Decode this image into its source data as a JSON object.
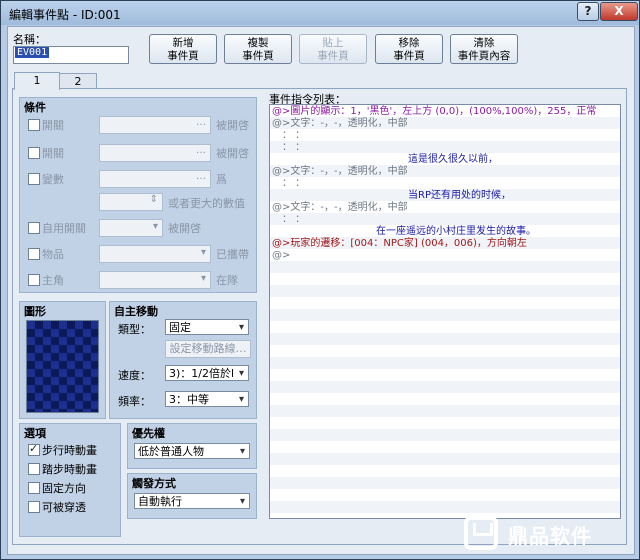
{
  "window": {
    "title": "編輯事件點 - ID:001",
    "help": "?",
    "close": "X"
  },
  "name": {
    "label": "名稱：",
    "value": "EV001"
  },
  "toolbar": [
    {
      "l1": "新增",
      "l2": "事件頁",
      "enabled": true
    },
    {
      "l1": "複製",
      "l2": "事件頁",
      "enabled": true
    },
    {
      "l1": "貼上",
      "l2": "事件頁",
      "enabled": false
    },
    {
      "l1": "移除",
      "l2": "事件頁",
      "enabled": true
    },
    {
      "l1": "清除",
      "l2": "事件頁內容",
      "enabled": true
    }
  ],
  "tabs": [
    "1",
    "2"
  ],
  "conditions": {
    "title": "條件",
    "switch1": {
      "label": "開關",
      "suffix": "被開啓"
    },
    "switch2": {
      "label": "開關",
      "suffix": "被開啓"
    },
    "variable": {
      "label": "變數",
      "suffix": "爲",
      "hint": "或者更大的數值"
    },
    "self_switch": {
      "label": "自用開關",
      "suffix": "被開啓"
    },
    "item": {
      "label": "物品",
      "suffix": "已攜帶"
    },
    "actor": {
      "label": "主角",
      "suffix": "在隊"
    }
  },
  "graphic": {
    "title": "圖形"
  },
  "autonomous": {
    "title": "自主移動",
    "type_label": "類型：",
    "type_value": "固定",
    "route_button": "設定移動路線…",
    "speed_label": "速度：",
    "speed_value": "3)：1/2倍於l",
    "freq_label": "頻率：",
    "freq_value": "3：中等"
  },
  "options": {
    "title": "選項",
    "items": [
      {
        "label": "步行時動畫",
        "checked": true
      },
      {
        "label": "踏步時動畫",
        "checked": false
      },
      {
        "label": "固定方向",
        "checked": false
      },
      {
        "label": "可被穿透",
        "checked": false
      }
    ]
  },
  "priority": {
    "title": "優先權",
    "value": "低於普通人物"
  },
  "trigger": {
    "title": "觸發方式",
    "value": "自動執行"
  },
  "command_list": {
    "title": "事件指令列表：",
    "lines": [
      {
        "text": "@>圖片的顯示：1，'黑色'，左上方 (0,0)，(100%,100%)，255，正常",
        "color": "#8b1aa0",
        "indent": 0
      },
      {
        "text": "@>文字：-，-，透明化，中部",
        "color": "#6e7884",
        "indent": 0
      },
      {
        "text": "：  ：",
        "color": "#6e7884",
        "indent": 10
      },
      {
        "text": "：  ：",
        "color": "#6e7884",
        "indent": 10
      },
      {
        "text": "這是很久很久以前，",
        "color": "#1a1aa8",
        "indent": 136
      },
      {
        "text": "@>文字：-，-，透明化，中部",
        "color": "#6e7884",
        "indent": 0
      },
      {
        "text": "：  ：",
        "color": "#6e7884",
        "indent": 10
      },
      {
        "text": "当RP还有用处的时候，",
        "color": "#1a1aa8",
        "indent": 136
      },
      {
        "text": "@>文字：-，-，透明化，中部",
        "color": "#6e7884",
        "indent": 0
      },
      {
        "text": "：  ：",
        "color": "#6e7884",
        "indent": 10
      },
      {
        "text": "在一座遥远的小村庄里发生的故事。",
        "color": "#1a1aa8",
        "indent": 104
      },
      {
        "text": "@>玩家的遷移：[004：NPC家] (004，006)，方向朝左",
        "color": "#a01a1a",
        "indent": 0
      },
      {
        "text": "@>",
        "color": "#6e7884",
        "indent": 0
      }
    ]
  },
  "watermark": {
    "text": "鼎品软件"
  }
}
